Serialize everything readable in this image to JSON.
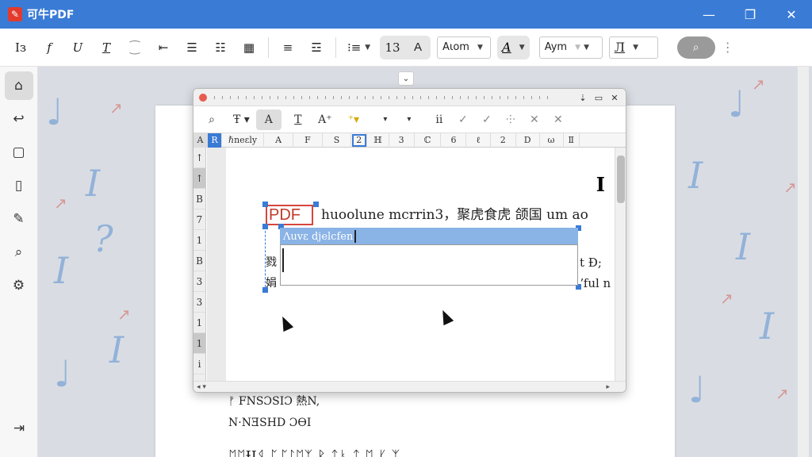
{
  "app": {
    "title": "可牛PDF",
    "logo": "pdf-logo-icon"
  },
  "window_controls": {
    "minimize": "—",
    "maximize": "❐",
    "close": "✕"
  },
  "toolbar": {
    "buttons": [
      {
        "icon": "text-style-icon",
        "label": "Iз"
      },
      {
        "icon": "italic-f-icon",
        "label": "f"
      },
      {
        "icon": "underline-icon",
        "label": "U"
      },
      {
        "icon": "strike-icon",
        "label": "T"
      },
      {
        "icon": "align-indent-icon",
        "label": "⁐"
      },
      {
        "icon": "align-left-icon",
        "label": "⇤"
      },
      {
        "icon": "align-center-icon",
        "label": "☰"
      },
      {
        "icon": "align-right-icon",
        "label": "☷"
      },
      {
        "icon": "justify-icon",
        "label": "▦"
      },
      {
        "icon": "line-spacing-icon",
        "label": "≡"
      },
      {
        "icon": "paragraph-icon",
        "label": "☲"
      },
      {
        "icon": "list-icon",
        "label": "⁝≡"
      }
    ],
    "size_value": "13",
    "font_a": "A",
    "font_select": "Aιom",
    "color_label": "A",
    "font_select2": "Aym",
    "style_select": "Л"
  },
  "sidebar": {
    "items": [
      {
        "icon": "home-icon",
        "glyph": "⌂"
      },
      {
        "icon": "hand-icon",
        "glyph": "↩"
      },
      {
        "icon": "comment-icon",
        "glyph": "▢"
      },
      {
        "icon": "page-icon",
        "glyph": "▯"
      },
      {
        "icon": "edit-icon",
        "glyph": "✎"
      },
      {
        "icon": "find-icon",
        "glyph": "⌕"
      },
      {
        "icon": "settings-icon",
        "glyph": "⚙"
      }
    ],
    "bottom_icon": "⇥"
  },
  "editor": {
    "title_buttons": [
      "⇣",
      "▭",
      "✕"
    ],
    "tools": [
      {
        "icon": "zoom-icon",
        "label": "⌕"
      },
      {
        "icon": "text-size-icon",
        "label": "Ŧ ▾"
      },
      {
        "icon": "font-icon",
        "label": "A"
      },
      {
        "icon": "text-tool-icon",
        "label": "T"
      },
      {
        "icon": "style-icon",
        "label": "A⁺"
      },
      {
        "icon": "highlight-icon",
        "label": "⁺▾"
      },
      {
        "icon": "more1-icon",
        "label": "▾"
      },
      {
        "icon": "more2-icon",
        "label": "▾"
      },
      {
        "icon": "fit-icon",
        "label": "ⅱ"
      },
      {
        "icon": "check-icon",
        "label": "✓"
      },
      {
        "icon": "check2-icon",
        "label": "✓"
      },
      {
        "icon": "grid-icon",
        "label": "⸭"
      },
      {
        "icon": "cross-icon",
        "label": "✕"
      },
      {
        "icon": "close-tool-icon",
        "label": "✕"
      }
    ],
    "tabs": [
      "A",
      "R",
      "ℏneɛly",
      "A",
      "F",
      "S",
      "2",
      "ℍ",
      "3",
      "ℂ",
      "6",
      "ℓ",
      "2",
      "D",
      "ω",
      "Ⅱ"
    ],
    "gutter": [
      "↑",
      "↑",
      "B",
      "7",
      "1",
      "B",
      "3",
      "3",
      "1",
      "1",
      "i"
    ],
    "line1_pdf": "PDF",
    "line1_rest": "huoolune mcrrin3，聚虎食虎 颌国 um ao",
    "highlight_text": "Λuvε djelcfen",
    "left_chars": [
      "戮",
      "娟"
    ],
    "right_line1": "t Đ;",
    "right_line2": "ʼful n",
    "big_letter": "I"
  },
  "page": {
    "lines": [
      "ᚠ FNSƆSIƆ  熱N,",
      "N·NƎSHD  ƆѲI",
      "ᛖᛖƗIᛩ ᛈᛢᛇᛖᛉ  ᛒ ᛏᛓ ᛏ  ᛖ  ᛕ  ᛉ"
    ],
    "big_letter": "I"
  }
}
